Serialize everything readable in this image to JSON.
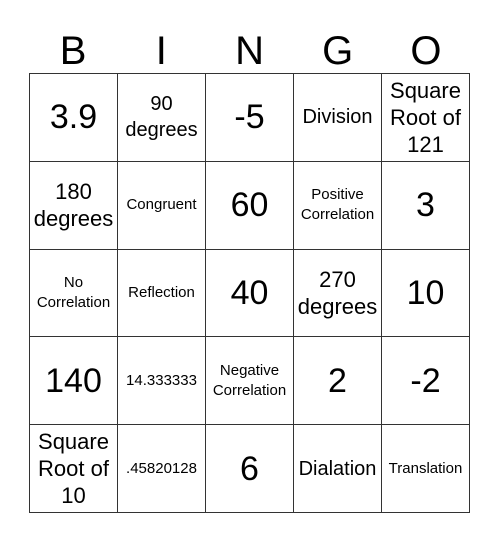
{
  "header": [
    "B",
    "I",
    "N",
    "G",
    "O"
  ],
  "cells": [
    {
      "text": "3.9",
      "size": "xl"
    },
    {
      "text": "90\ndegrees",
      "size": "m"
    },
    {
      "text": "-5",
      "size": "xl"
    },
    {
      "text": "Division",
      "size": "m"
    },
    {
      "text": "Square\nRoot of\n121",
      "size": "l"
    },
    {
      "text": "180\ndegrees",
      "size": "l"
    },
    {
      "text": "Congruent",
      "size": "s"
    },
    {
      "text": "60",
      "size": "xl"
    },
    {
      "text": "Positive\nCorrelation",
      "size": "s"
    },
    {
      "text": "3",
      "size": "xl"
    },
    {
      "text": "No\nCorrelation",
      "size": "s"
    },
    {
      "text": "Reflection",
      "size": "s"
    },
    {
      "text": "40",
      "size": "xl"
    },
    {
      "text": "270\ndegrees",
      "size": "l"
    },
    {
      "text": "10",
      "size": "xl"
    },
    {
      "text": "140",
      "size": "xl"
    },
    {
      "text": "14.333333",
      "size": "s"
    },
    {
      "text": "Negative\nCorrelation",
      "size": "s"
    },
    {
      "text": "2",
      "size": "xl"
    },
    {
      "text": "-2",
      "size": "xl"
    },
    {
      "text": "Square\nRoot of\n10",
      "size": "l"
    },
    {
      "text": ".45820128",
      "size": "s"
    },
    {
      "text": "6",
      "size": "xl"
    },
    {
      "text": "Dialation",
      "size": "m"
    },
    {
      "text": "Translation",
      "size": "s"
    }
  ]
}
